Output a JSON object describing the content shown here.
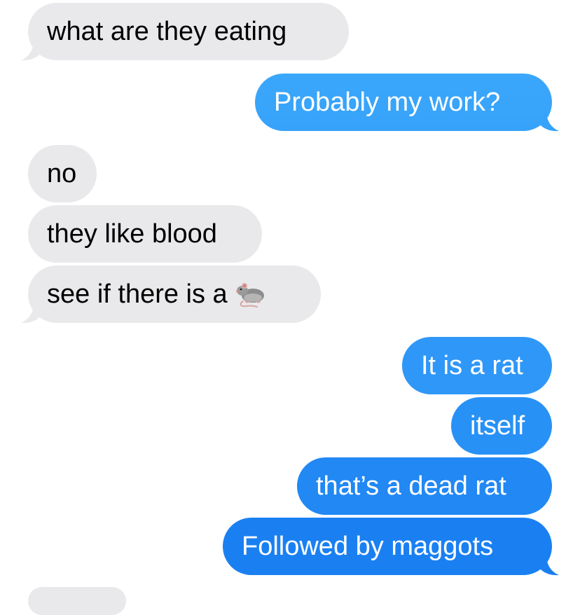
{
  "conversation": {
    "messages": [
      {
        "side": "in",
        "text": "what are they eating"
      },
      {
        "side": "out",
        "text": "Probably my work?"
      },
      {
        "side": "in",
        "text": "no"
      },
      {
        "side": "in",
        "text": "they like blood"
      },
      {
        "side": "in",
        "text": "see if there is a",
        "emoji": "rat-icon"
      },
      {
        "side": "out",
        "text": "It is a rat"
      },
      {
        "side": "out",
        "text": "itself"
      },
      {
        "side": "out",
        "text": "that’s a dead rat"
      },
      {
        "side": "out",
        "text": "Followed by maggots"
      }
    ]
  },
  "colors": {
    "incoming_bubble": "#e9e9eb",
    "outgoing_gradient_top": "#3aa7fb",
    "outgoing_gradient_bottom": "#1a7ef2",
    "incoming_text": "#000000",
    "outgoing_text": "#ffffff"
  }
}
